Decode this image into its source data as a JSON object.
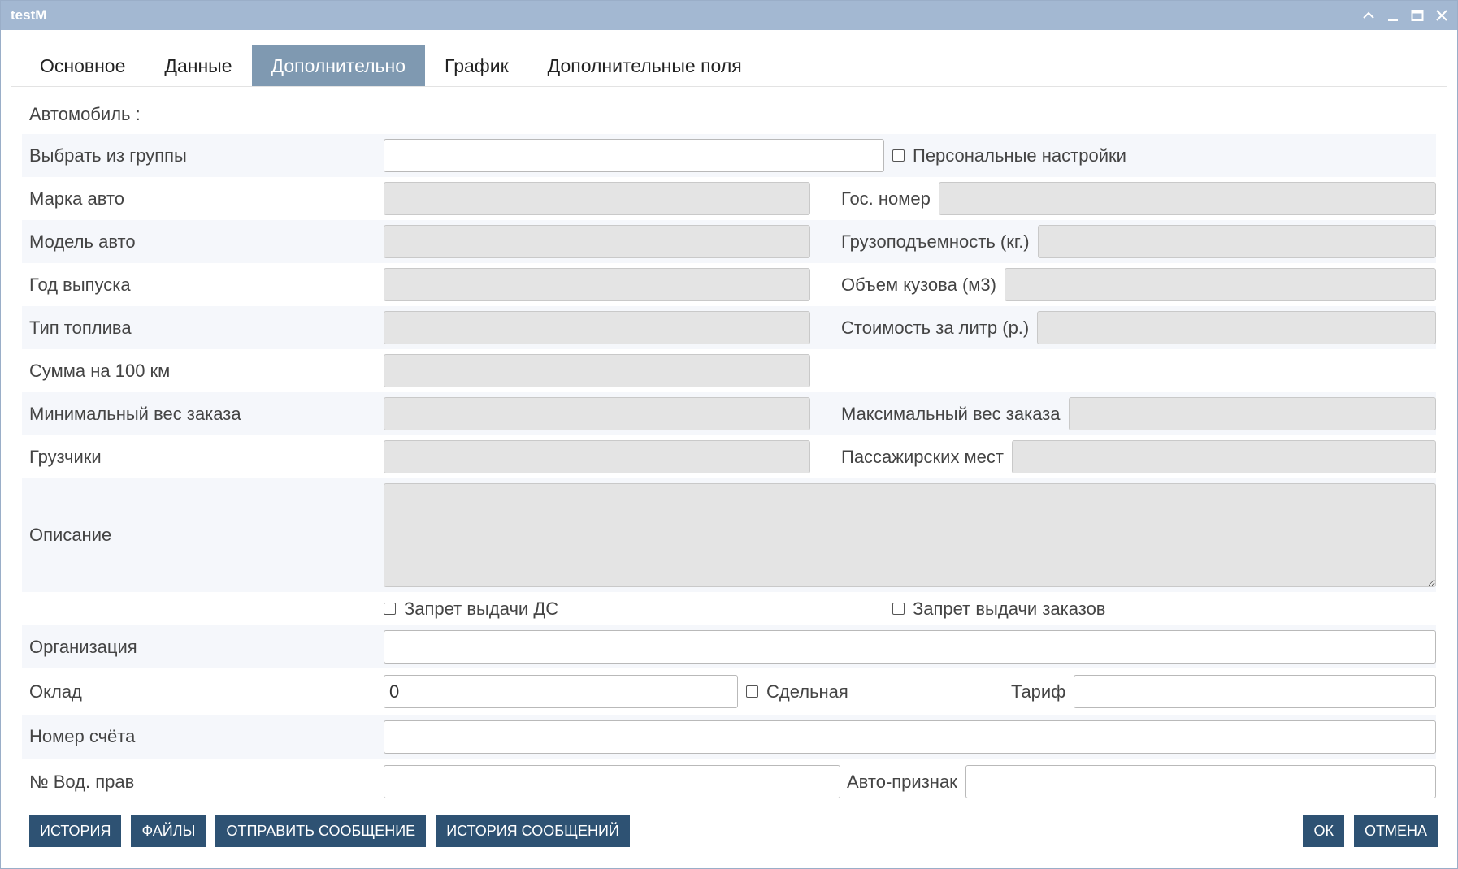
{
  "window": {
    "title": "testM"
  },
  "tabs": [
    {
      "label": "Основное"
    },
    {
      "label": "Данные"
    },
    {
      "label": "Дополнительно"
    },
    {
      "label": "График"
    },
    {
      "label": "Дополнительные поля"
    }
  ],
  "active_tab": "Дополнительно",
  "section": {
    "label": "Автомобиль :"
  },
  "fields": {
    "group": {
      "label": "Выбрать из группы",
      "value": ""
    },
    "personal": {
      "label": "Персональные настройки",
      "checked": false
    },
    "brand": {
      "label": "Марка авто",
      "value": ""
    },
    "plate": {
      "label": "Гос. номер",
      "value": ""
    },
    "model": {
      "label": "Модель авто",
      "value": ""
    },
    "capacity": {
      "label": "Грузоподъемность (кг.)",
      "value": ""
    },
    "year": {
      "label": "Год выпуска",
      "value": ""
    },
    "volume": {
      "label": "Объем кузова (м3)",
      "value": ""
    },
    "fuel": {
      "label": "Тип топлива",
      "value": ""
    },
    "fuel_cost": {
      "label": "Стоимость за литр (р.)",
      "value": ""
    },
    "sum100": {
      "label": "Сумма на 100 км",
      "value": ""
    },
    "min_weight": {
      "label": "Минимальный вес заказа",
      "value": ""
    },
    "max_weight": {
      "label": "Максимальный вес заказа",
      "value": ""
    },
    "loaders": {
      "label": "Грузчики",
      "value": ""
    },
    "seats": {
      "label": "Пассажирских мест",
      "value": ""
    },
    "description": {
      "label": "Описание",
      "value": ""
    },
    "ban_ds": {
      "label": "Запрет выдачи ДС",
      "checked": false
    },
    "ban_orders": {
      "label": "Запрет выдачи заказов",
      "checked": false
    },
    "org": {
      "label": "Организация",
      "value": ""
    },
    "salary": {
      "label": "Оклад",
      "value": "0"
    },
    "piecework": {
      "label": "Сдельная",
      "checked": false
    },
    "tariff": {
      "label": "Тариф",
      "value": ""
    },
    "account": {
      "label": "Номер счёта",
      "value": ""
    },
    "license": {
      "label": "№ Вод. прав",
      "value": ""
    },
    "auto_sign": {
      "label": "Авто-признак",
      "value": ""
    }
  },
  "buttons": {
    "history": "ИСТОРИЯ",
    "files": "ФАЙЛЫ",
    "send_message": "ОТПРАВИТЬ СООБЩЕНИЕ",
    "message_history": "ИСТОРИЯ СООБЩЕНИЙ",
    "ok": "ОК",
    "cancel": "ОТМЕНА"
  },
  "colors": {
    "titlebar": "#a3b8d2",
    "active_tab": "#7f99b1",
    "button": "#2e5273",
    "disabled_input": "#e4e4e4"
  }
}
